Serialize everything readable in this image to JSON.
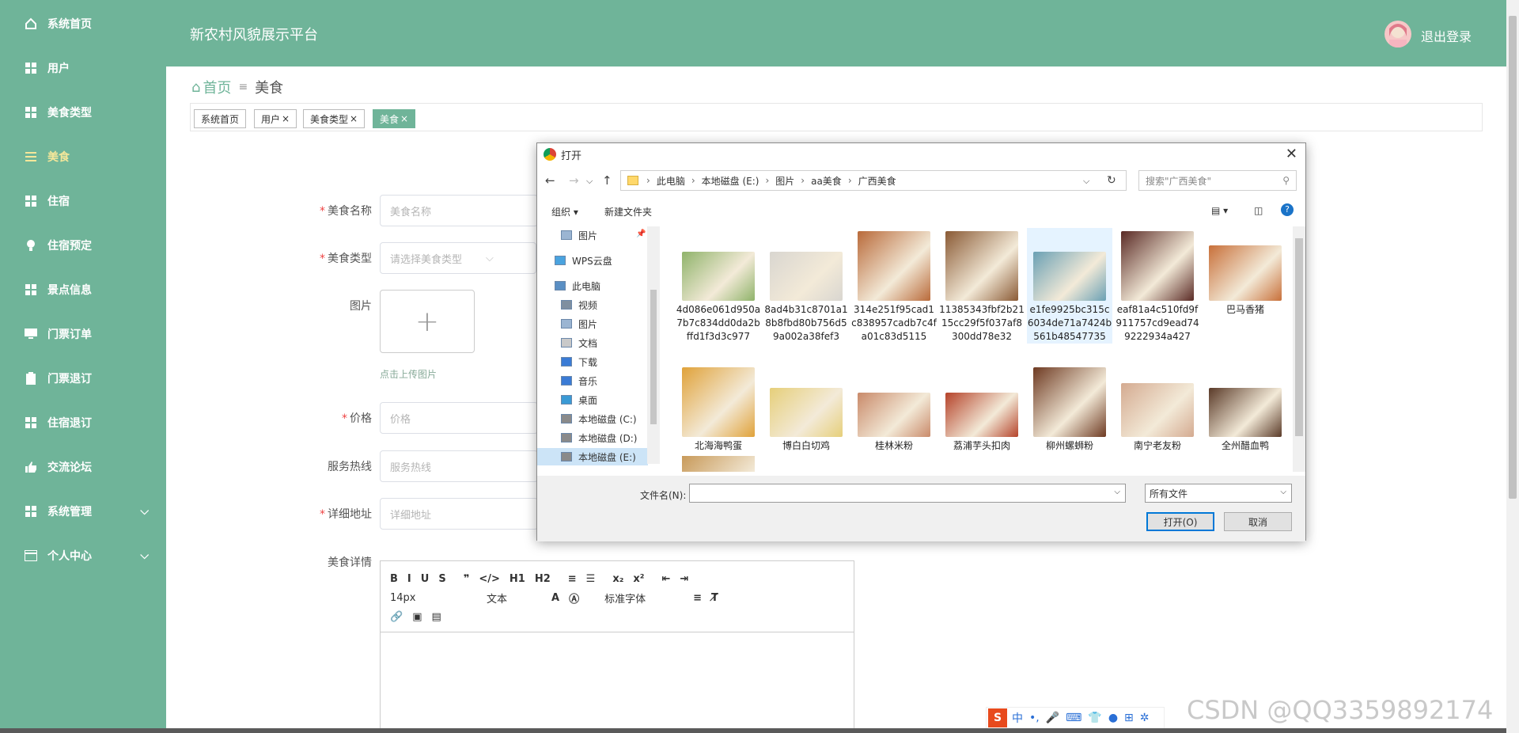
{
  "sidebar": {
    "items": [
      {
        "label": "系统首页",
        "icon": "home-icon"
      },
      {
        "label": "用户",
        "icon": "grid-icon"
      },
      {
        "label": "美食类型",
        "icon": "grid-icon"
      },
      {
        "label": "美食",
        "icon": "list-icon",
        "active": true
      },
      {
        "label": "住宿",
        "icon": "grid-icon"
      },
      {
        "label": "住宿预定",
        "icon": "bulb-icon"
      },
      {
        "label": "景点信息",
        "icon": "grid-icon"
      },
      {
        "label": "门票订单",
        "icon": "monitor-icon"
      },
      {
        "label": "门票退订",
        "icon": "clipboard-icon"
      },
      {
        "label": "住宿退订",
        "icon": "grid-icon"
      },
      {
        "label": "交流论坛",
        "icon": "thumb-icon"
      },
      {
        "label": "系统管理",
        "icon": "grid-icon",
        "chevron": true
      },
      {
        "label": "个人中心",
        "icon": "card-icon",
        "chevron": true
      }
    ]
  },
  "header": {
    "title": "新农村风貌展示平台",
    "logout": "退出登录"
  },
  "breadcrumb": {
    "home": "首页",
    "current": "美食"
  },
  "tags": [
    {
      "label": "系统首页",
      "closable": false,
      "active": false
    },
    {
      "label": "用户",
      "closable": true,
      "active": false
    },
    {
      "label": "美食类型",
      "closable": true,
      "active": false
    },
    {
      "label": "美食",
      "closable": true,
      "active": true
    }
  ],
  "form": {
    "name_label": "美食名称",
    "name_placeholder": "美食名称",
    "type_label": "美食类型",
    "type_placeholder": "请选择美食类型",
    "image_label": "图片",
    "upload_hint": "点击上传图片",
    "price_label": "价格",
    "price_placeholder": "价格",
    "hotline_label": "服务热线",
    "hotline_placeholder": "服务热线",
    "address_label": "详细地址",
    "address_placeholder": "详细地址",
    "detail_label": "美食详情"
  },
  "editor": {
    "row1": [
      "B",
      "I",
      "U",
      "S",
      "❞",
      "</>",
      "H1",
      "H2",
      "≡",
      "☰",
      "x₂",
      "x²",
      "⇤",
      "⇥"
    ],
    "font_size": "14px",
    "text_style": "文本",
    "font_family": "标准字体",
    "clear": "T̸"
  },
  "dialog": {
    "title": "打开",
    "path": [
      "此电脑",
      "本地磁盘 (E:)",
      "图片",
      "aa美食",
      "广西美食"
    ],
    "search_placeholder": "搜索\"广西美食\"",
    "organize": "组织 ▾",
    "new_folder": "新建文件夹",
    "nav": [
      {
        "label": "图片",
        "indent": 2
      },
      {
        "label": "WPS云盘",
        "indent": 1
      },
      {
        "label": "此电脑",
        "indent": 1
      },
      {
        "label": "视频",
        "indent": 2
      },
      {
        "label": "图片",
        "indent": 2
      },
      {
        "label": "文档",
        "indent": 2
      },
      {
        "label": "下载",
        "indent": 2
      },
      {
        "label": "音乐",
        "indent": 2
      },
      {
        "label": "桌面",
        "indent": 2
      },
      {
        "label": "本地磁盘 (C:)",
        "indent": 2
      },
      {
        "label": "本地磁盘 (D:)",
        "indent": 2
      },
      {
        "label": "本地磁盘 (E:)",
        "indent": 2,
        "selected": true
      }
    ],
    "files": [
      {
        "name": "4d086e061d950a7b7c834dd0da2bffd1f3d3c977",
        "color": "#8fb36a"
      },
      {
        "name": "8ad4b31c8701a18b8fbd80b756d59a002a38fef3",
        "color": "#d9d6d0"
      },
      {
        "name": "314e251f95cad1c838957cadb7c4fa01c83d5115",
        "color": "#b96a3a"
      },
      {
        "name": "11385343fbf2b2115cc29f5f037af8300dd78e32",
        "color": "#8a5a35"
      },
      {
        "name": "e1fe9925bc315c6034de71a7424b561b48547735",
        "color": "#6aa0b4",
        "selected": true
      },
      {
        "name": "eaf81a4c510fd9f911757cd9ead749222934a427",
        "color": "#5a2a25"
      },
      {
        "name": "巴马香猪",
        "color": "#c8703a"
      },
      {
        "name": "北海海鸭蛋",
        "color": "#e0a23a"
      },
      {
        "name": "博白白切鸡",
        "color": "#e6cf7a"
      },
      {
        "name": "桂林米粉",
        "color": "#c98a6a"
      },
      {
        "name": "荔浦芋头扣肉",
        "color": "#b5432a"
      },
      {
        "name": "柳州螺蛳粉",
        "color": "#6e3a22"
      },
      {
        "name": "南宁老友粉",
        "color": "#d4aa90"
      },
      {
        "name": "全州醋血鸭",
        "color": "#5a3a28"
      }
    ],
    "filename_label": "文件名(N):",
    "filetype": "所有文件",
    "open_button": "打开(O)",
    "cancel_button": "取消"
  },
  "ime": [
    "中",
    "•,",
    "🎤",
    "⌨",
    "👕",
    "●",
    "⊞",
    "✲"
  ],
  "watermark": "CSDN @QQ3359892174"
}
